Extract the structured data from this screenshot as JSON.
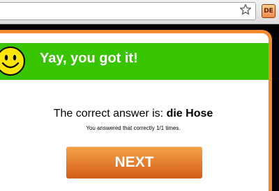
{
  "browser": {
    "extension_badge": "DE",
    "icons": [
      "star-icon",
      "extension-icon"
    ]
  },
  "popup": {
    "banner_text": "Yay, you got it!",
    "icon": "smiley-icon",
    "answer_prefix": "The correct answer is:",
    "answer_word": "die Hose",
    "stats_text": "You answered that correctly 1/1 times.",
    "next_label": "NEXT"
  },
  "colors": {
    "banner_green": "#39c400",
    "accent_orange": "#f5892b",
    "button_orange": "#e77a2c"
  }
}
